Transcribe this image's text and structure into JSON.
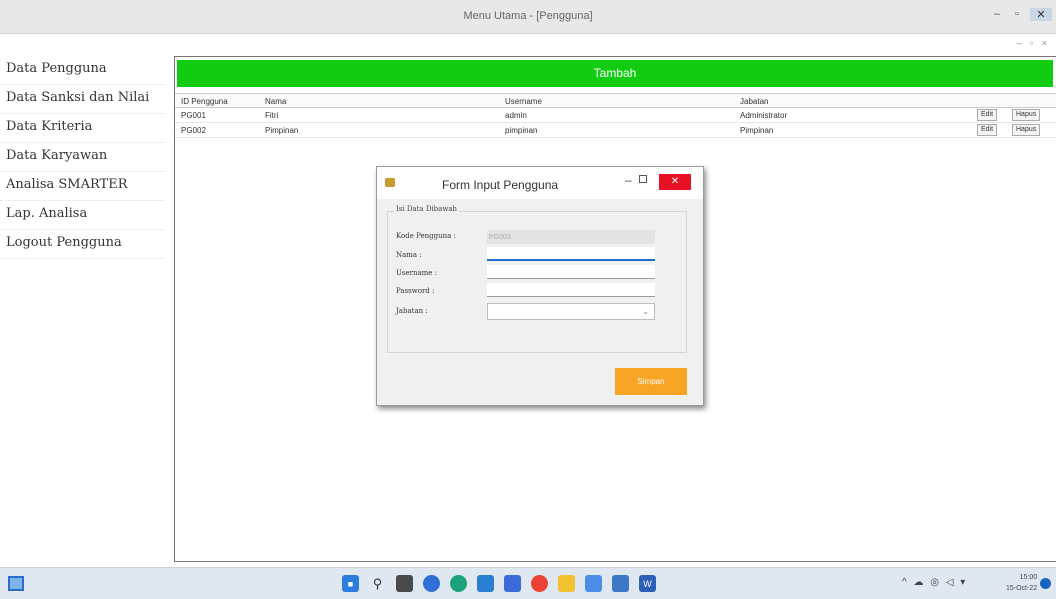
{
  "window": {
    "title": "Menu Utama - [Pengguna]",
    "controls": {
      "minimize": "–",
      "maximize": "▫",
      "close": "✕"
    },
    "sub_controls": "– ▫ ×"
  },
  "sidebar": {
    "items": [
      {
        "label": "Data Pengguna"
      },
      {
        "label": "Data Sanksi dan Nilai"
      },
      {
        "label": "Data Kriteria"
      },
      {
        "label": "Data Karyawan"
      },
      {
        "label": "Analisa SMARTER"
      },
      {
        "label": "Lap. Analisa"
      },
      {
        "label": "Logout Pengguna"
      }
    ]
  },
  "main": {
    "add_button": "Tambah",
    "table": {
      "headers": [
        "ID Pengguna",
        "Nama",
        "Username",
        "Jabatan"
      ],
      "rows": [
        {
          "id": "PG001",
          "nama": "Fitri",
          "username": "admin",
          "jabatan": "Administrator"
        },
        {
          "id": "PG002",
          "nama": "Pimpinan",
          "username": "pimpinan",
          "jabatan": "Pimpinan"
        }
      ],
      "edit_label": "Edit",
      "delete_label": "Hapus"
    }
  },
  "dialog": {
    "title": "Form Input Pengguna",
    "close_label": "✕",
    "group_label": "Isi Data Dibawah",
    "fields": {
      "kode_label": "Kode Pengguna :",
      "kode_value": "PG003",
      "nama_label": "Nama :",
      "username_label": "Username :",
      "password_label": "Password :",
      "jabatan_label": "Jabatan :"
    },
    "save_button": "Simpan"
  },
  "taskbar": {
    "tray": "^ ☁ ◎ ◁ ▾",
    "time": "15:00",
    "date": "15-Oct-22"
  },
  "colors": {
    "accent_green": "#12cc12",
    "save_orange": "#f7a425",
    "close_red": "#e81123"
  }
}
